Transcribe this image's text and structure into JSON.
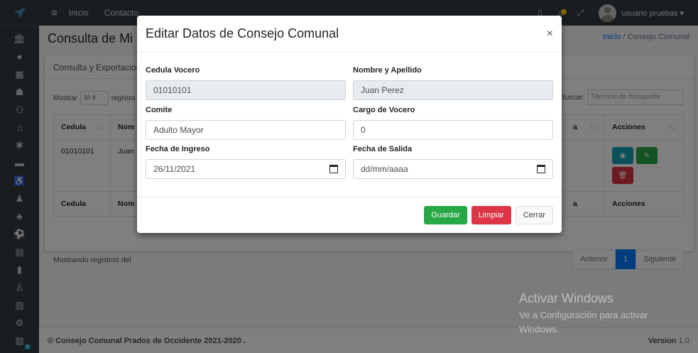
{
  "navbar": {
    "links": [
      "Inicio",
      "Contacto"
    ],
    "username": "usuario pruebas"
  },
  "sidebar": {
    "badge": "6"
  },
  "page": {
    "title": "Consulta de Mi",
    "breadcrumb_home": "Inicio",
    "breadcrumb_sep": "/",
    "breadcrumb_current": "Consejo Comunal",
    "card_title": "Consulta y Exportacion",
    "show_label": "Mostrar",
    "show_value": "10",
    "records_label": "registro",
    "search_label": "Buscar:",
    "search_placeholder": "Término de búsqueda",
    "table": {
      "headers": [
        "Cedula",
        "Nom",
        "a",
        "Acciones"
      ],
      "row": {
        "cedula": "01010101",
        "nombre": "Juan"
      }
    },
    "info": "Mostrando registros del",
    "pagination": {
      "prev": "Anterior",
      "page": "1",
      "next": "Siguiente"
    },
    "footer_text": "© Consejo Comunal Prados de Occidente 2021-2020 .",
    "version_label": "Version",
    "version_value": "1.0"
  },
  "modal": {
    "title": "Editar Datos de Consejo Comunal",
    "close": "×",
    "fields": {
      "cedula": {
        "label": "Cedula Vocero",
        "value": "01010101"
      },
      "nombre": {
        "label": "Nombre y Apellido",
        "value": "Juan Perez"
      },
      "comite": {
        "label": "Comite",
        "value": "Adulto Mayor"
      },
      "cargo": {
        "label": "Cargo de Vocero",
        "value": "0"
      },
      "ingreso": {
        "label": "Fecha de Ingreso",
        "value": "26/11/2021"
      },
      "salida": {
        "label": "Fecha de Salida",
        "value": "dd/mm/aaaa"
      }
    },
    "buttons": {
      "save": "Guardar",
      "clear": "Limpiar",
      "close": "Cerrar"
    }
  },
  "watermark": {
    "title": "Activar Windows",
    "subtitle": "Ve a Configuración para activar Windows."
  },
  "colors": {
    "primary": "#007bff",
    "success": "#28a745",
    "danger": "#dc3545",
    "info": "#17a2b8",
    "dark": "#343a40"
  }
}
